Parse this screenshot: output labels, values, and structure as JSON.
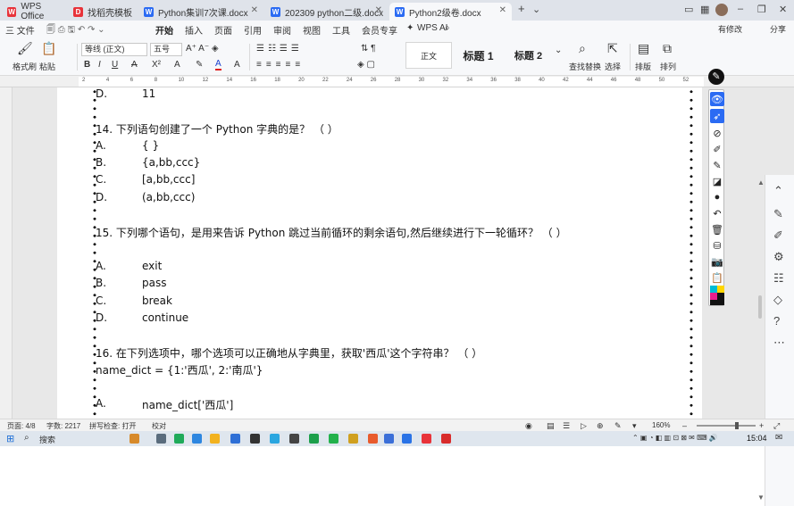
{
  "tabs": [
    {
      "label": "WPS Office",
      "icon": "wps-logo",
      "color": "#e8333a"
    },
    {
      "label": "找稻壳模板",
      "icon": "docer-logo",
      "color": "#e8333a"
    },
    {
      "label": "Python集训7次课.docx",
      "icon": "word-doc",
      "color": "#2b6bf3"
    },
    {
      "label": "202309 python二级.docx",
      "icon": "word-doc",
      "color": "#2b6bf3"
    },
    {
      "label": "Python2级卷.docx",
      "icon": "word-doc",
      "color": "#2b6bf3"
    }
  ],
  "menu": {
    "left": [
      "三 文件"
    ],
    "items": [
      "开始",
      "插入",
      "页面",
      "引用",
      "审阅",
      "视图",
      "工具",
      "会员专享"
    ],
    "active": "开始",
    "ai": "WPS AI",
    "right": [
      "有修改",
      "分享"
    ]
  },
  "ribbon": {
    "format_painter": "格式刷",
    "paste": "粘贴",
    "font_name": "等线 (正文)",
    "font_size": "五号",
    "style_normal": "正文",
    "style_h1": "标题 1",
    "style_h2": "标题 2",
    "find_replace": "查找替换",
    "select": "选择",
    "layout": "排版",
    "arrange": "排列"
  },
  "ruler_numbers": [
    "2",
    "4",
    "6",
    "8",
    "10",
    "12",
    "14",
    "16",
    "18",
    "20",
    "22",
    "24",
    "26",
    "28",
    "30",
    "32",
    "34",
    "36",
    "38",
    "40",
    "42",
    "44",
    "46",
    "48",
    "50",
    "52"
  ],
  "document": {
    "lines": [
      {
        "text": "D.",
        "tab": "11",
        "indent": true
      },
      {
        "text": "14.   下列语句创建了一个 Python 字典的是？ （    ）"
      },
      {
        "text": "A.",
        "tab": "{ }",
        "indent": true
      },
      {
        "text": "B.",
        "tab": "{a,bb,ccc}",
        "indent": true
      },
      {
        "text": "C.",
        "tab": "[a,bb,ccc]",
        "indent": true
      },
      {
        "text": "D.",
        "tab": "(a,bb,ccc)",
        "indent": true
      },
      {
        "text": "15.   下列哪个语句，是用来告诉 Python 跳过当前循环的剩余语句,然后继续进行下一轮循环？ （    ）"
      },
      {
        "text": "A.",
        "tab": "exit",
        "indent": true
      },
      {
        "text": "B.",
        "tab": "pass",
        "indent": true
      },
      {
        "text": "C.",
        "tab": "break",
        "indent": true
      },
      {
        "text": "D.",
        "tab": "continue",
        "indent": true
      },
      {
        "text": "16.   在下列选项中，哪个选项可以正确地从字典里，获取'西瓜'这个字符串？ （    ）"
      },
      {
        "text": "name_dict = {1:'西瓜', 2:'南瓜'}"
      },
      {
        "text": "A.",
        "tab": "name_dict['西瓜']",
        "indent": true
      }
    ]
  },
  "status": {
    "page": "页面: 4/8",
    "words": "字数: 2217",
    "spell": "拼写检查: 打开",
    "proof": "校对",
    "zoom": "160%"
  },
  "taskbar": {
    "search": "搜索",
    "time": "15:04"
  }
}
